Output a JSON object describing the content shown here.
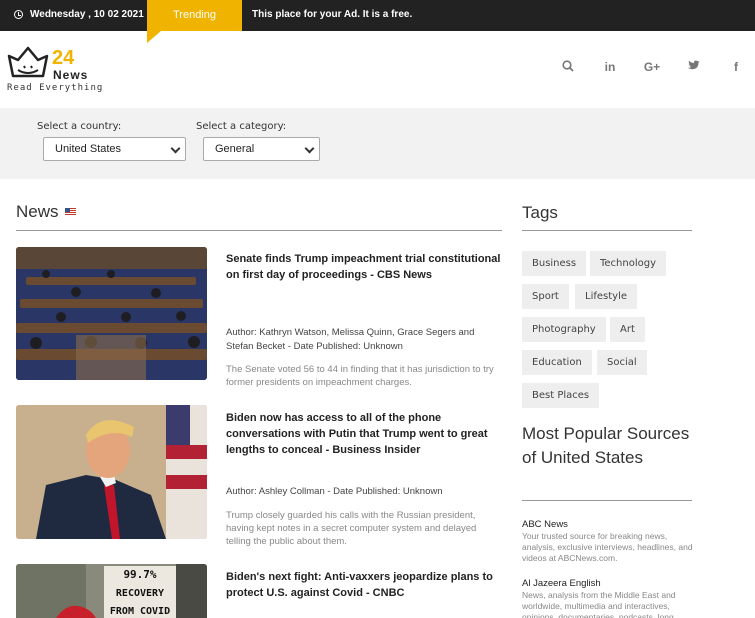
{
  "topbar": {
    "date": "Wednesday , 10 02 2021",
    "trending": "Trending",
    "ad": "This place for your Ad. It is a free."
  },
  "logo": {
    "number": "24",
    "brand": "News",
    "tagline": "Read Everything"
  },
  "social": [
    "search-icon",
    "linkedin-icon",
    "google-plus-icon",
    "twitter-icon",
    "facebook-icon"
  ],
  "filters": {
    "country_label": "Select a country:",
    "country_value": "United States",
    "category_label": "Select a category:",
    "category_value": "General"
  },
  "news": {
    "heading": "News",
    "articles": [
      {
        "title": "Senate finds Trump impeachment trial constitutional on first day of proceedings - CBS News",
        "author": "Author: Kathryn Watson, Melissa Quinn, Grace Segers and Stefan Becket - Date Published: Unknown",
        "description": "The Senate voted 56 to 44 in finding that it has jurisdiction to try former presidents on impeachment charges."
      },
      {
        "title": "Biden now has access to all of the phone conversations with Putin that Trump went to great lengths to conceal - Business Insider",
        "author": "Author: Ashley Collman - Date Published: Unknown",
        "description": "Trump closely guarded his calls with the Russian president, having kept notes in a secret computer system and delayed telling the public about them."
      },
      {
        "title": "Biden's next fight: Anti-vaxxers jeopardize plans to protect U.S. against Covid - CNBC",
        "sign_text": "99.7% RECOVERY FROM COVID"
      }
    ]
  },
  "sidebar": {
    "tags_heading": "Tags",
    "tags": [
      "Business",
      "Technology",
      "Sport",
      "Lifestyle",
      "Photography",
      "Art",
      "Education",
      "Social",
      "Best Places"
    ],
    "popular_heading": "Most Popular Sources of United States",
    "sources": [
      {
        "name": "ABC News",
        "description": "Your trusted source for breaking news, analysis, exclusive interviews, headlines, and videos at ABCNews.com."
      },
      {
        "name": "Al Jazeera English",
        "description": "News, analysis from the Middle East and worldwide, multimedia and interactives, opinions, documentaries, podcasts, long"
      }
    ]
  }
}
